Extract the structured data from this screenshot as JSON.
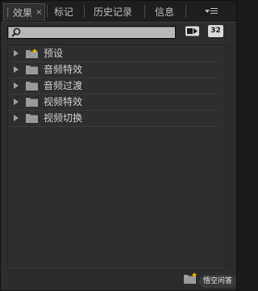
{
  "tabs": [
    {
      "label": "效果",
      "close": "×",
      "active": true
    },
    {
      "label": "标记"
    },
    {
      "label": "历史记录"
    },
    {
      "label": "信息"
    }
  ],
  "search": {
    "placeholder": "",
    "value": ""
  },
  "toolbar": {
    "accelerated_icon": "accelerated-effects-icon",
    "bit32_label": "32"
  },
  "tree": [
    {
      "label": "预设",
      "icon": "preset-folder-icon"
    },
    {
      "label": "音频特效",
      "icon": "folder-icon"
    },
    {
      "label": "音频过渡",
      "icon": "folder-icon"
    },
    {
      "label": "视频特效",
      "icon": "folder-icon"
    },
    {
      "label": "视频切换",
      "icon": "folder-icon"
    }
  ],
  "watermark": {
    "text": "悟空问答"
  },
  "colors": {
    "panel_bg": "#2c2c2c",
    "tab_bg": "#1e1e1e",
    "text": "#c8c8c8",
    "folder": "#9b9b9b",
    "preset_star": "#f0c000"
  }
}
